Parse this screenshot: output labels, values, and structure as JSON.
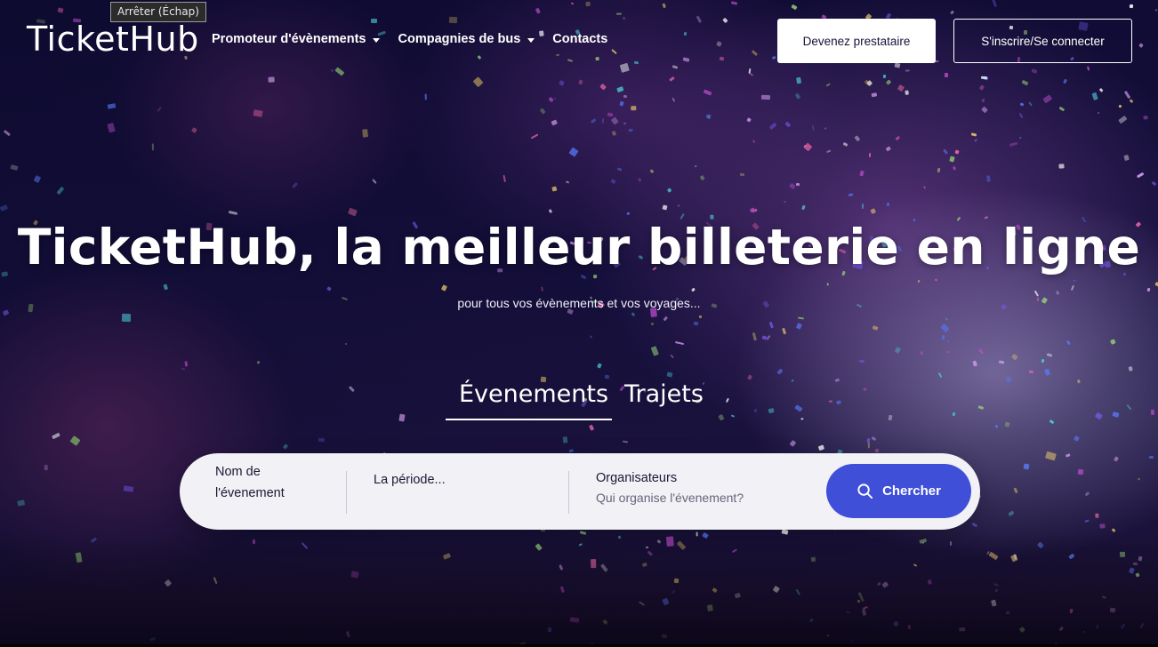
{
  "tooltip": "Arrêter (Échap)",
  "header": {
    "logo": "TicketHub",
    "nav": [
      {
        "label": "Promoteur d'évènements",
        "dropdown": true
      },
      {
        "label": "Compagnies de bus",
        "dropdown": true
      },
      {
        "label": "Contacts",
        "dropdown": false
      }
    ],
    "provider_button": "Devenez prestataire",
    "login_button": "S'inscrire/Se connecter"
  },
  "hero": {
    "title": "TicketHub, la meilleur billeterie en ligne",
    "subtitle": "pour tous vos évènements et vos voyages..."
  },
  "tabs": [
    {
      "label": "Évenements",
      "active": true
    },
    {
      "label": "Trajets",
      "active": false
    }
  ],
  "search": {
    "event_name_label": "Nom de l'évenement",
    "period_placeholder": "La période...",
    "organizers_label": "Organisateurs",
    "organizers_placeholder": "Qui organise l'évenement?",
    "submit_label": "Chercher",
    "accent_color": "#3f4fd8"
  },
  "colors": {
    "background": "#100c35",
    "text": "#ffffff"
  }
}
